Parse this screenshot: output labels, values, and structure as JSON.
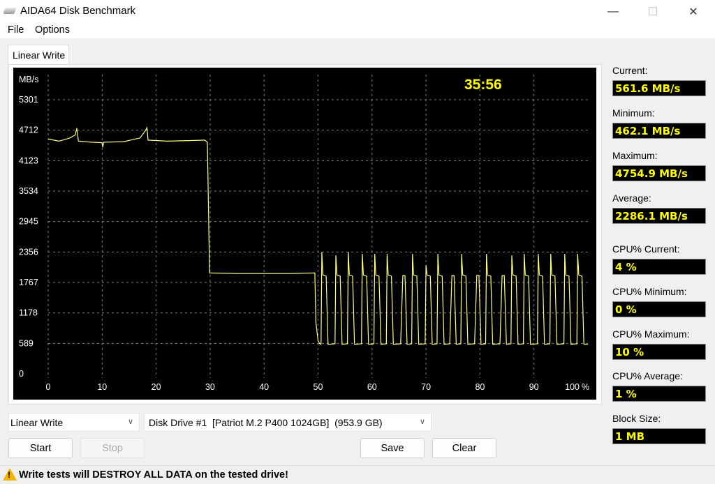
{
  "window": {
    "title": "AIDA64 Disk Benchmark",
    "minimize": "—",
    "maximize": "☐",
    "close": "✕"
  },
  "menu": {
    "file": "File",
    "options": "Options"
  },
  "tab": {
    "label": "Linear Write"
  },
  "chart_data": {
    "type": "line",
    "ylabel": "MB/s",
    "timer": "35:56",
    "y_ticks": [
      0,
      589,
      1178,
      1767,
      2356,
      2945,
      3534,
      4123,
      4712,
      5301
    ],
    "x_ticks": [
      0,
      10,
      20,
      30,
      40,
      50,
      60,
      70,
      80,
      90,
      100
    ],
    "x_unit": "%",
    "xlim": [
      0,
      100
    ],
    "ylim": [
      0,
      5890
    ],
    "grid": true,
    "colors": {
      "background": "#000000",
      "line": "#ffff80",
      "grid": "#808080",
      "text": "#ffffff",
      "timer": "#ffff00"
    },
    "points": [
      [
        0,
        4540
      ],
      [
        2,
        4500
      ],
      [
        4,
        4560
      ],
      [
        5,
        4620
      ],
      [
        5.3,
        4750
      ],
      [
        5.6,
        4500
      ],
      [
        8,
        4480
      ],
      [
        10,
        4470
      ],
      [
        10.1,
        4380
      ],
      [
        10.3,
        4480
      ],
      [
        14,
        4490
      ],
      [
        17,
        4560
      ],
      [
        18,
        4700
      ],
      [
        18.3,
        4760
      ],
      [
        18.5,
        4520
      ],
      [
        22,
        4500
      ],
      [
        26,
        4510
      ],
      [
        29,
        4520
      ],
      [
        29.5,
        4480
      ],
      [
        29.9,
        1950
      ],
      [
        35,
        1940
      ],
      [
        40,
        1940
      ],
      [
        45,
        1940
      ],
      [
        49.4,
        1950
      ],
      [
        49.6,
        1000
      ],
      [
        50,
        640
      ],
      [
        50.4,
        570
      ],
      [
        50.55,
        580
      ],
      [
        50.7,
        2356
      ],
      [
        50.9,
        1910
      ],
      [
        51.5,
        1890
      ],
      [
        51.85,
        570
      ],
      [
        53.15,
        580
      ],
      [
        53.3,
        2290
      ],
      [
        53.5,
        1910
      ],
      [
        54.1,
        1890
      ],
      [
        54.45,
        570
      ],
      [
        55.45,
        580
      ],
      [
        55.6,
        2356
      ],
      [
        55.8,
        1910
      ],
      [
        56.4,
        1890
      ],
      [
        56.75,
        570
      ],
      [
        58.05,
        580
      ],
      [
        58.2,
        2320
      ],
      [
        58.4,
        1910
      ],
      [
        59.0,
        1890
      ],
      [
        59.35,
        570
      ],
      [
        60.35,
        580
      ],
      [
        60.5,
        2320
      ],
      [
        60.7,
        1910
      ],
      [
        61.3,
        1890
      ],
      [
        61.65,
        570
      ],
      [
        62.65,
        580
      ],
      [
        62.8,
        2320
      ],
      [
        63.0,
        1910
      ],
      [
        63.6,
        1890
      ],
      [
        63.95,
        570
      ],
      [
        65.3,
        580
      ],
      [
        65.7,
        1900
      ],
      [
        66.1,
        1900
      ],
      [
        66.5,
        570
      ],
      [
        67.35,
        580
      ],
      [
        67.5,
        2320
      ],
      [
        67.7,
        1910
      ],
      [
        68.3,
        1890
      ],
      [
        68.65,
        570
      ],
      [
        69.85,
        580
      ],
      [
        70.0,
        2100
      ],
      [
        70.2,
        1910
      ],
      [
        70.8,
        1890
      ],
      [
        71.15,
        570
      ],
      [
        72.05,
        580
      ],
      [
        72.2,
        2320
      ],
      [
        72.4,
        1910
      ],
      [
        73.0,
        1890
      ],
      [
        73.35,
        570
      ],
      [
        74.4,
        580
      ],
      [
        74.8,
        1900
      ],
      [
        75.2,
        1900
      ],
      [
        75.6,
        570
      ],
      [
        76.45,
        580
      ],
      [
        76.6,
        2320
      ],
      [
        76.8,
        1910
      ],
      [
        77.4,
        1890
      ],
      [
        77.75,
        570
      ],
      [
        79.0,
        580
      ],
      [
        79.4,
        1900
      ],
      [
        79.8,
        1900
      ],
      [
        80.2,
        570
      ],
      [
        81.05,
        580
      ],
      [
        81.2,
        2320
      ],
      [
        81.4,
        1910
      ],
      [
        82.0,
        1890
      ],
      [
        82.35,
        570
      ],
      [
        83.7,
        580
      ],
      [
        84.1,
        1900
      ],
      [
        84.5,
        1900
      ],
      [
        84.9,
        570
      ],
      [
        85.75,
        580
      ],
      [
        85.9,
        2290
      ],
      [
        86.1,
        1910
      ],
      [
        86.7,
        1890
      ],
      [
        87.05,
        570
      ],
      [
        88.05,
        580
      ],
      [
        88.2,
        2320
      ],
      [
        88.4,
        1910
      ],
      [
        89.0,
        1890
      ],
      [
        89.35,
        570
      ],
      [
        90.65,
        580
      ],
      [
        90.8,
        2320
      ],
      [
        91.0,
        1910
      ],
      [
        91.6,
        1890
      ],
      [
        91.95,
        570
      ],
      [
        92.95,
        580
      ],
      [
        93.1,
        2320
      ],
      [
        93.3,
        1910
      ],
      [
        93.9,
        1890
      ],
      [
        94.25,
        570
      ],
      [
        95.55,
        580
      ],
      [
        95.7,
        2320
      ],
      [
        95.9,
        1910
      ],
      [
        96.5,
        1890
      ],
      [
        96.85,
        570
      ],
      [
        97.95,
        580
      ],
      [
        98.1,
        2320
      ],
      [
        98.3,
        1910
      ],
      [
        98.9,
        1890
      ],
      [
        99.25,
        570
      ],
      [
        100,
        570
      ]
    ]
  },
  "stats": [
    {
      "label": "Current:",
      "value": "561.6 MB/s"
    },
    {
      "label": "Minimum:",
      "value": "462.1 MB/s"
    },
    {
      "label": "Maximum:",
      "value": "4754.9 MB/s"
    },
    {
      "label": "Average:",
      "value": "2286.1 MB/s"
    },
    {
      "label": "CPU% Current:",
      "value": "4 %"
    },
    {
      "label": "CPU% Minimum:",
      "value": "0 %"
    },
    {
      "label": "CPU% Maximum:",
      "value": "10 %"
    },
    {
      "label": "CPU% Average:",
      "value": "1 %"
    },
    {
      "label": "Block Size:",
      "value": "1 MB"
    }
  ],
  "controls": {
    "test_select": "Linear Write",
    "drive_select": "Disk Drive #1  [Patriot M.2 P400 1024GB]  (953.9 GB)",
    "start": "Start",
    "stop": "Stop",
    "save": "Save",
    "clear": "Clear"
  },
  "status": {
    "warning": "Write tests will DESTROY ALL DATA on the tested drive!"
  }
}
